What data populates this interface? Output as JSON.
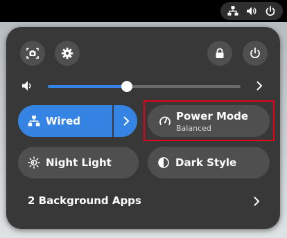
{
  "top_bar": {
    "icons": [
      "network-wired-icon",
      "volume-icon",
      "power-icon"
    ]
  },
  "quick_settings": {
    "top_buttons": {
      "screenshot": "screenshot-icon",
      "settings": "gear-icon",
      "lock": "lock-icon",
      "power": "power-icon"
    },
    "volume": {
      "icon": "volume-icon",
      "level_percent": 41,
      "arrow": "chevron-right-icon"
    },
    "tiles": {
      "wired": {
        "label": "Wired",
        "icon": "network-wired-icon",
        "active": true
      },
      "power_mode": {
        "label": "Power Mode",
        "sublabel": "Balanced",
        "icon": "power-mode-icon"
      },
      "night_light": {
        "label": "Night Light",
        "icon": "night-light-icon"
      },
      "dark_style": {
        "label": "Dark Style",
        "icon": "dark-style-icon"
      }
    },
    "background_apps": {
      "label": "2 Background Apps",
      "arrow": "chevron-right-icon"
    }
  },
  "colors": {
    "accent": "#3584e4",
    "panel": "#383838",
    "tile": "#4f4f4f",
    "highlight": "#e4001b"
  }
}
